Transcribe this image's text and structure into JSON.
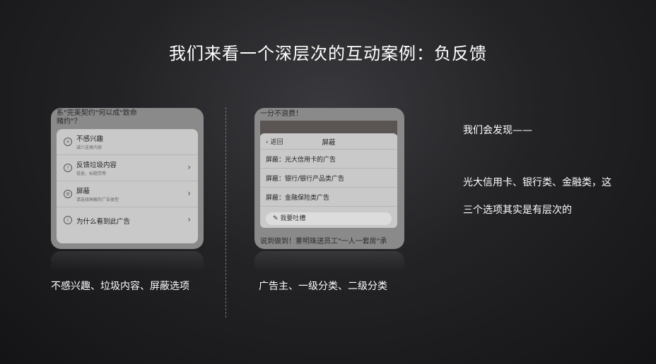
{
  "title": "我们来看一个深层次的互动案例：负反馈",
  "left_card": {
    "peek_lines": [
      "系\"完美契约\"何以成\"致命",
      "赌约\"？"
    ],
    "items": [
      {
        "label": "不感兴趣",
        "sub": "减少这类内容",
        "icon": "x-circle-icon"
      },
      {
        "label": "反馈垃圾内容",
        "sub": "低俗，标题党等",
        "icon": "warning-icon"
      },
      {
        "label": "屏蔽",
        "sub": "请选择屏蔽的广告类型",
        "icon": "block-icon"
      },
      {
        "label": "为什么看到此广告",
        "sub": "",
        "icon": "info-icon"
      }
    ],
    "caption": "不感兴趣、垃圾内容、屏蔽选项"
  },
  "right_card": {
    "peek_top": "一分不浪费！",
    "back_label": "返回",
    "panel_title": "屏蔽",
    "items": [
      "屏蔽：光大信用卡的广告",
      "屏蔽：银行/银行产品类广告",
      "屏蔽：金融保险类广告"
    ],
    "pill": "我要吐槽",
    "peek_bottom": "说到做到！董明珠送员工\"一人一套房\"承",
    "caption": "广告主、一级分类、二级分类"
  },
  "side_text": {
    "line1": "我们会发现——",
    "line2": "光大信用卡、银行类、金融类，这",
    "line3": "三个选项其实是有层次的"
  }
}
